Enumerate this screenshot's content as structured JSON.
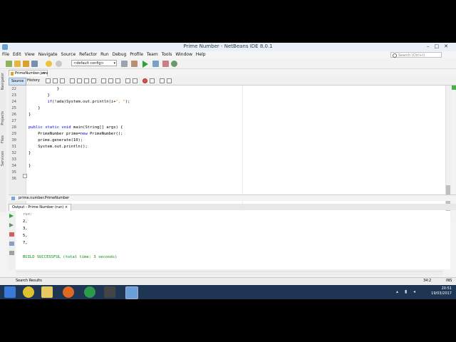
{
  "window": {
    "title": "Prime Number - NetBeans IDE 8.0.1"
  },
  "menu": [
    "File",
    "Edit",
    "View",
    "Navigate",
    "Source",
    "Refactor",
    "Run",
    "Debug",
    "Profile",
    "Team",
    "Tools",
    "Window",
    "Help"
  ],
  "search": {
    "placeholder": "Search (Ctrl+I)"
  },
  "toolbar": {
    "config": "<default config>"
  },
  "sidepanels": [
    "Navigator",
    "Projects",
    "Files",
    "Services"
  ],
  "editor": {
    "tab": "PrimeNumber.java",
    "source_label": "Source",
    "history_label": "History",
    "lines": [
      {
        "n": "22",
        "t": "            }"
      },
      {
        "n": "23",
        "t": "        }"
      },
      {
        "n": "24",
        "t": "        if(!ada)System.out.println(i+\", \");"
      },
      {
        "n": "25",
        "t": "    }"
      },
      {
        "n": "26",
        "t": "}"
      },
      {
        "n": "27",
        "t": ""
      },
      {
        "n": "28",
        "t": "public static void main(String[] args) {"
      },
      {
        "n": "29",
        "t": "    PrimeNumber prime=new PrimeNumber();"
      },
      {
        "n": "30",
        "t": "    prime.generate(10);"
      },
      {
        "n": "31",
        "t": "    System.out.println();"
      },
      {
        "n": "32",
        "t": "}"
      },
      {
        "n": "33",
        "t": ""
      },
      {
        "n": "34",
        "t": "}"
      },
      {
        "n": "35",
        "t": ""
      },
      {
        "n": "36",
        "t": ""
      }
    ]
  },
  "navigator": {
    "breadcrumb": "prime.number.PrimeNumber"
  },
  "output": {
    "tab": "Output - Prime Number (run)",
    "lines": [
      "run:",
      "2,",
      "3,",
      "5,",
      "7,",
      "",
      "BUILD SUCCESSFUL (total time: 3 seconds)"
    ]
  },
  "status": {
    "left": "Search Results",
    "position": "34:2",
    "mode": "INS"
  },
  "taskbar": {
    "time": "20:51",
    "date": "19/03/2017"
  },
  "colors": {
    "keyword": "#0000e6",
    "string": "#ce7b00",
    "success": "#118811",
    "taskbar": "#1e3653"
  }
}
